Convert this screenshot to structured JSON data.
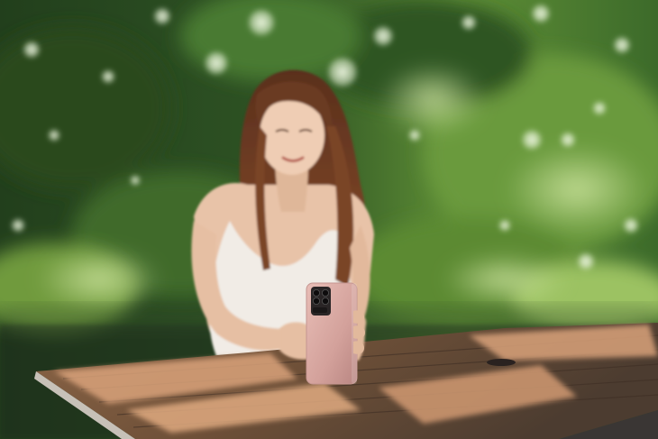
{
  "photo": {
    "subjects": [
      "person",
      "smartphone",
      "wooden-table",
      "trees"
    ],
    "colors": {
      "foliage_dark": "#1e3a18",
      "foliage_mid": "#3f6b2a",
      "foliage_light": "#8fbf5a",
      "bokeh": "#e8f4d8",
      "hair": "#6b3a22",
      "skin": "#e8c3a8",
      "dress": "#f1ece6",
      "phone_body": "#d9a9a3",
      "camera_module": "#2a2526",
      "table_top": "#7a5a40",
      "table_highlight": "#d9a27a",
      "table_shadow": "#3a3634"
    }
  }
}
